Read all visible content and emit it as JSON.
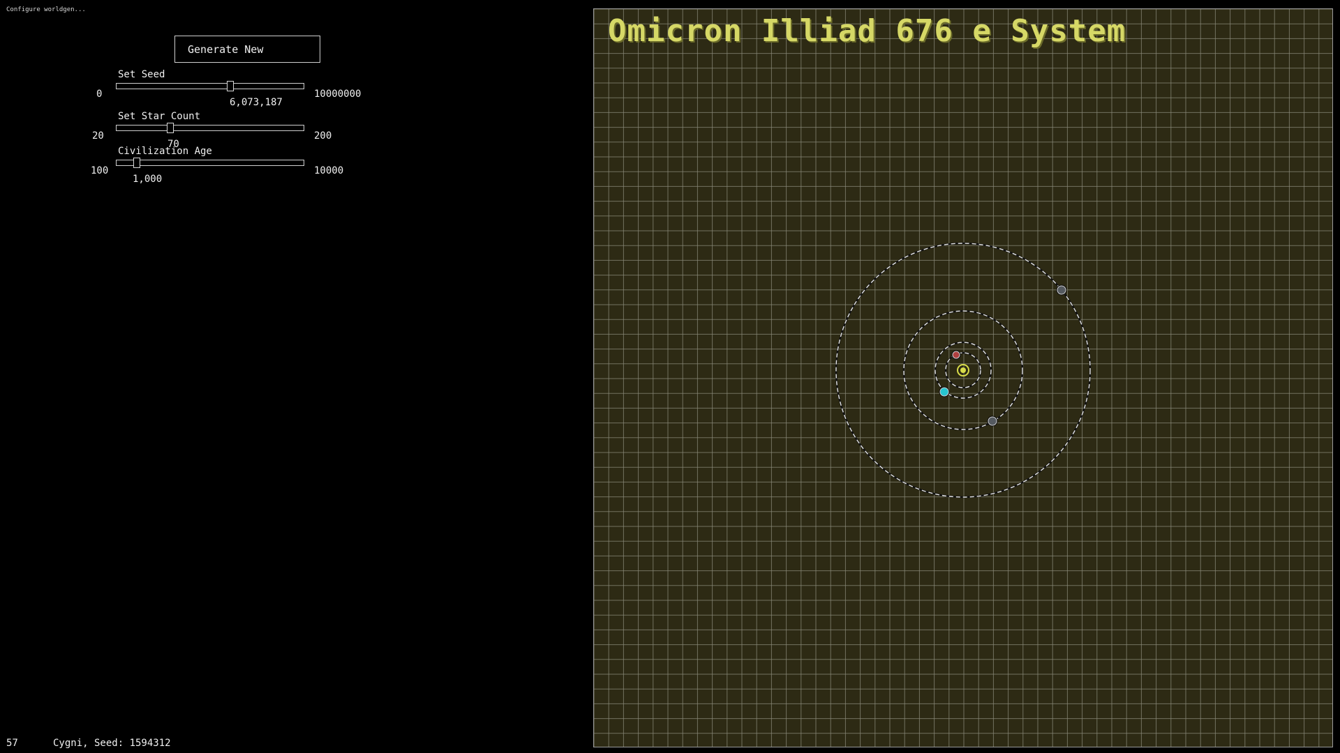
{
  "status_line": "Configure worldgen...",
  "controls": {
    "generate_label": "Generate New",
    "seed": {
      "label": "Set Seed",
      "min": "0",
      "max": "10000000",
      "value": "6,073,187",
      "fraction": 0.607
    },
    "star_count": {
      "label": "Set Star Count",
      "min": "20",
      "max": "200",
      "value": "70",
      "fraction": 0.278
    },
    "civ_age": {
      "label": "Civilization Age",
      "min": "100",
      "max": "10000",
      "value": "1,000",
      "fraction": 0.091
    }
  },
  "footer": {
    "fps": "57",
    "info": "Cygni, Seed: 1594312"
  },
  "map": {
    "title": "Omicron Illiad 676 e System",
    "background": "#2d2a14",
    "grid_color": "#8a8a7a",
    "star_color": "#d8dc4a",
    "orbit_color": "#e8e8e8",
    "planets": [
      {
        "name": "planet-red-icon",
        "color": "#b04040"
      },
      {
        "name": "planet-cyan-icon",
        "color": "#27c6d0"
      },
      {
        "name": "planet-gray-inner-icon",
        "color": "#555a60"
      },
      {
        "name": "planet-gray-outer-icon",
        "color": "#555a60"
      }
    ]
  }
}
